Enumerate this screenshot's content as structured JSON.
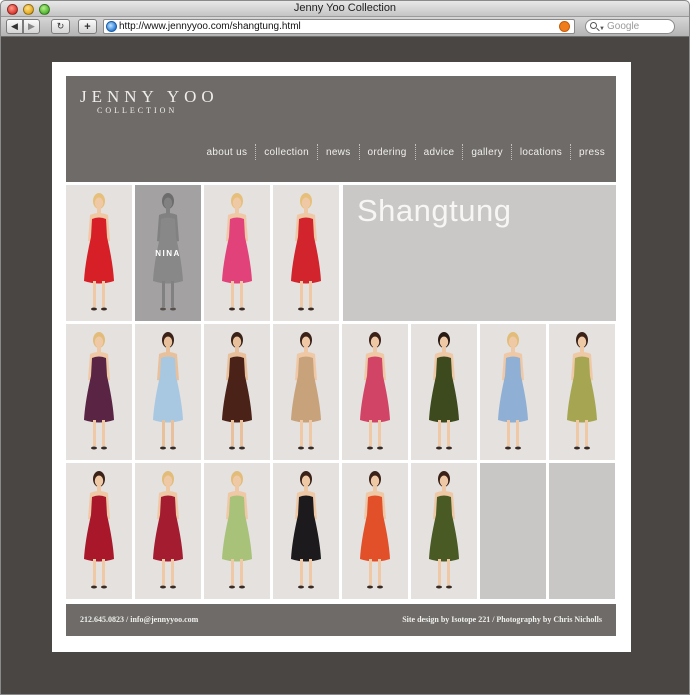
{
  "window": {
    "title": "Jenny Yoo Collection"
  },
  "browser": {
    "url": "http://www.jennyyoo.com/shangtung.html",
    "search_placeholder": "Google"
  },
  "header": {
    "logo_main": "JENNY YOO",
    "logo_sub": "COLLECTION",
    "nav": [
      "about us",
      "collection",
      "news",
      "ordering",
      "advice",
      "gallery",
      "locations",
      "press"
    ]
  },
  "hero": {
    "title": "Shangtung"
  },
  "rows": [
    [
      {
        "dress": "#d61f26",
        "skin": "#efc9a6",
        "hair": "#e6c07a"
      },
      {
        "dress": "#a8a8a8",
        "skin": "#9a9a9a",
        "hair": "#6b6b6b",
        "label": "NINA"
      },
      {
        "dress": "#e2427a",
        "skin": "#efc9a6",
        "hair": "#e6c07a"
      },
      {
        "dress": "#d2242c",
        "skin": "#efc9a6",
        "hair": "#e6c07a"
      }
    ],
    [
      {
        "dress": "#5a2444",
        "skin": "#efc9a6",
        "hair": "#e2bd7a"
      },
      {
        "dress": "#a8c8e2",
        "skin": "#e8c19c",
        "hair": "#3a2218"
      },
      {
        "dress": "#4a2218",
        "skin": "#e8c19c",
        "hair": "#3a2218"
      },
      {
        "dress": "#c8a27a",
        "skin": "#efc9a6",
        "hair": "#3a2218"
      },
      {
        "dress": "#d24466",
        "skin": "#efc9a6",
        "hair": "#3a2218"
      },
      {
        "dress": "#3c4a1e",
        "skin": "#efc9a6",
        "hair": "#2a1a14"
      },
      {
        "dress": "#8fb0d4",
        "skin": "#efc9a6",
        "hair": "#e2bd7a"
      },
      {
        "dress": "#a6a652",
        "skin": "#efc9a6",
        "hair": "#3a2218"
      }
    ],
    [
      {
        "dress": "#a8182a",
        "skin": "#efc9a6",
        "hair": "#3a2218"
      },
      {
        "dress": "#a41c30",
        "skin": "#efc9a6",
        "hair": "#e2bd7a"
      },
      {
        "dress": "#a8c27a",
        "skin": "#efc9a6",
        "hair": "#e2bd7a"
      },
      {
        "dress": "#1c1a1c",
        "skin": "#efc9a6",
        "hair": "#3a2218"
      },
      {
        "dress": "#e2502a",
        "skin": "#efc9a6",
        "hair": "#3a2218"
      },
      {
        "dress": "#4a5a24",
        "skin": "#efc9a6",
        "hair": "#3a2218"
      }
    ]
  ],
  "footer": {
    "contact": "212.645.0823 / info@jennyyoo.com",
    "credits": "Site design by Isotope 221 / Photography by Chris Nicholls"
  }
}
